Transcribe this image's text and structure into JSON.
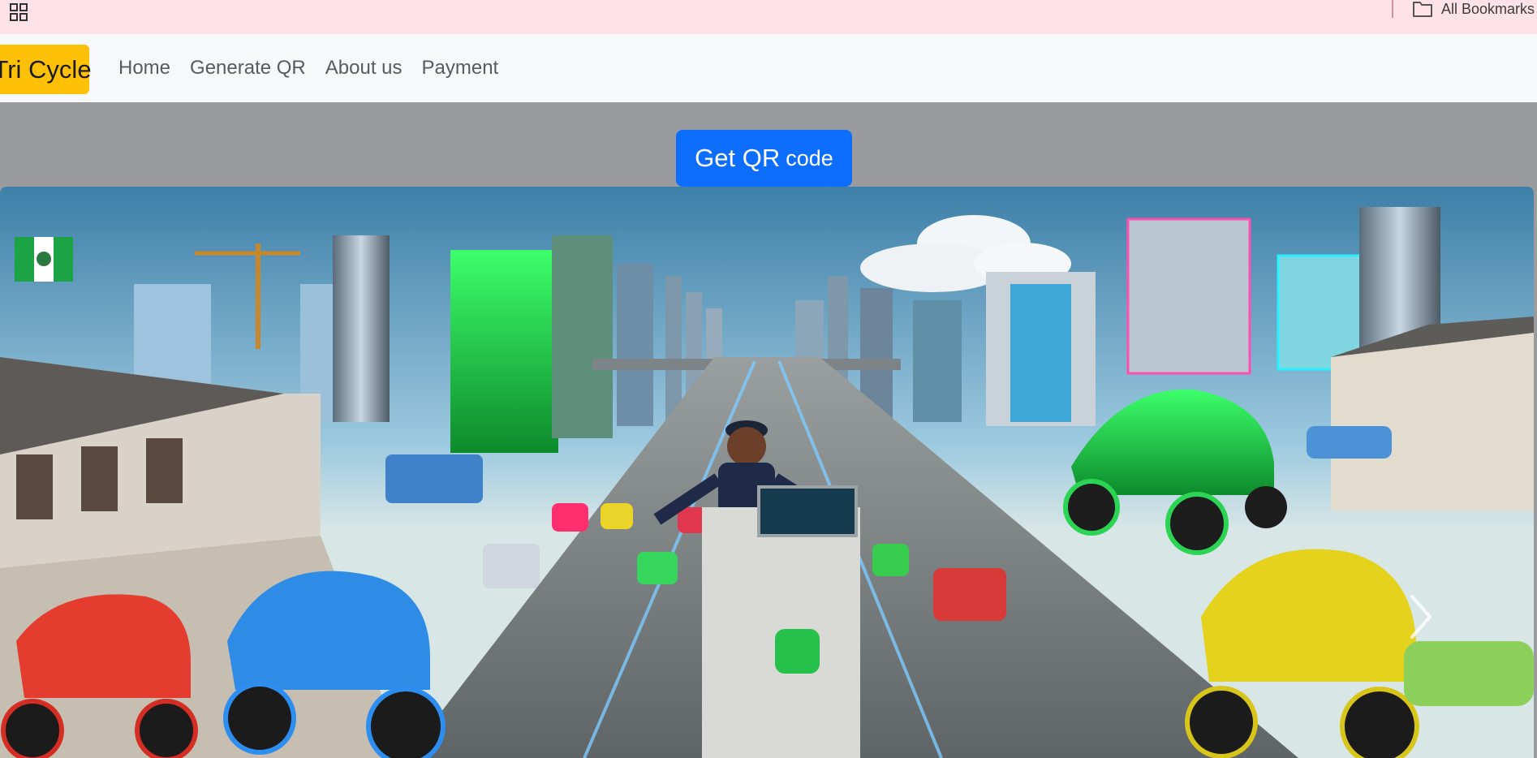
{
  "browser": {
    "apps_icon": "apps-grid-icon",
    "all_bookmarks_label": "All Bookmarks",
    "folder_icon": "folder-icon"
  },
  "navbar": {
    "brand": "Tri Cycle",
    "brand_color": "#ffc107",
    "links": [
      "Home",
      "Generate QR",
      "About us",
      "Payment"
    ]
  },
  "hero": {
    "qr_button_main": "Get QR",
    "qr_button_small": "code",
    "button_color": "#0d6efd"
  },
  "carousel": {
    "next_icon": "chevron-right-icon"
  }
}
